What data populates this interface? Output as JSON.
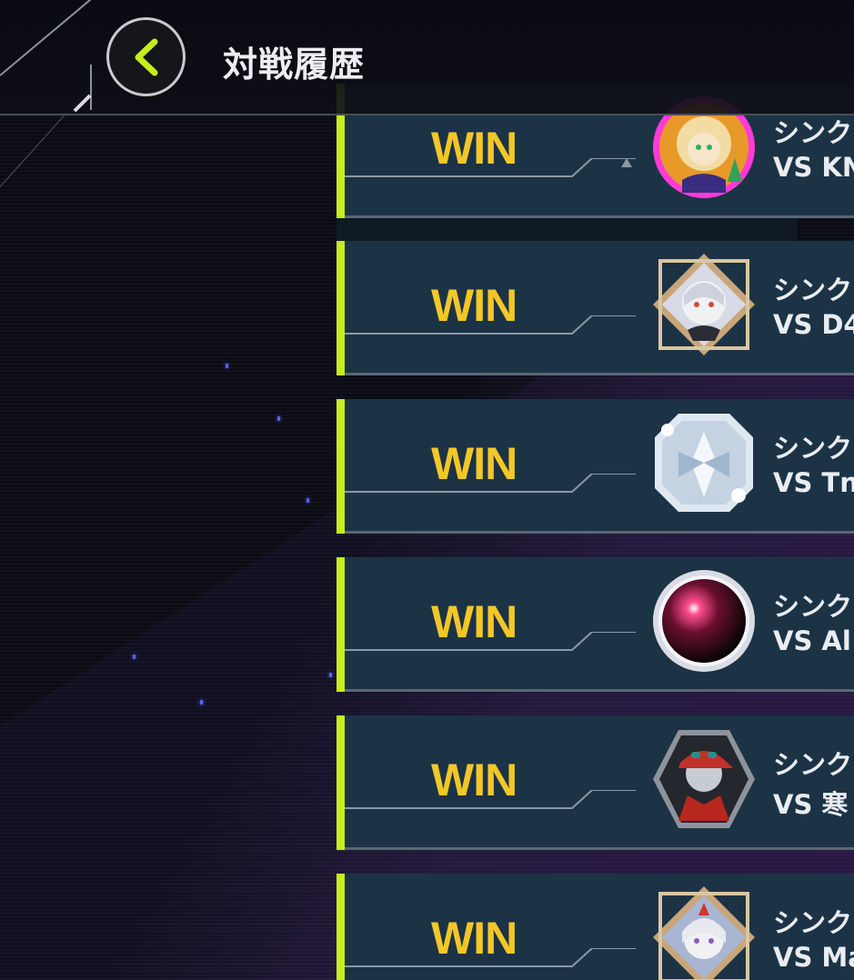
{
  "header": {
    "title": "対戦履歴",
    "back_icon": "chevron-left-icon"
  },
  "colors": {
    "accent": "#c5ee1c",
    "win": "#f3c727",
    "row_bg": "#1c3346"
  },
  "matches": [
    {
      "result": "WIN",
      "mode": "シンク",
      "opponent": "VS KN",
      "avatar_icon": "character-avatar-icon"
    },
    {
      "result": "WIN",
      "mode": "シンク",
      "opponent": "VS D4",
      "avatar_icon": "character-avatar-icon"
    },
    {
      "result": "WIN",
      "mode": "シンク",
      "opponent": "VS Tn",
      "avatar_icon": "character-avatar-icon"
    },
    {
      "result": "WIN",
      "mode": "シンク",
      "opponent": "VS Al",
      "avatar_icon": "orb-avatar-icon"
    },
    {
      "result": "WIN",
      "mode": "シンク",
      "opponent": "VS 寒",
      "avatar_icon": "character-avatar-icon"
    },
    {
      "result": "WIN",
      "mode": "シンク",
      "opponent": "VS Ma",
      "avatar_icon": "character-avatar-icon"
    }
  ]
}
